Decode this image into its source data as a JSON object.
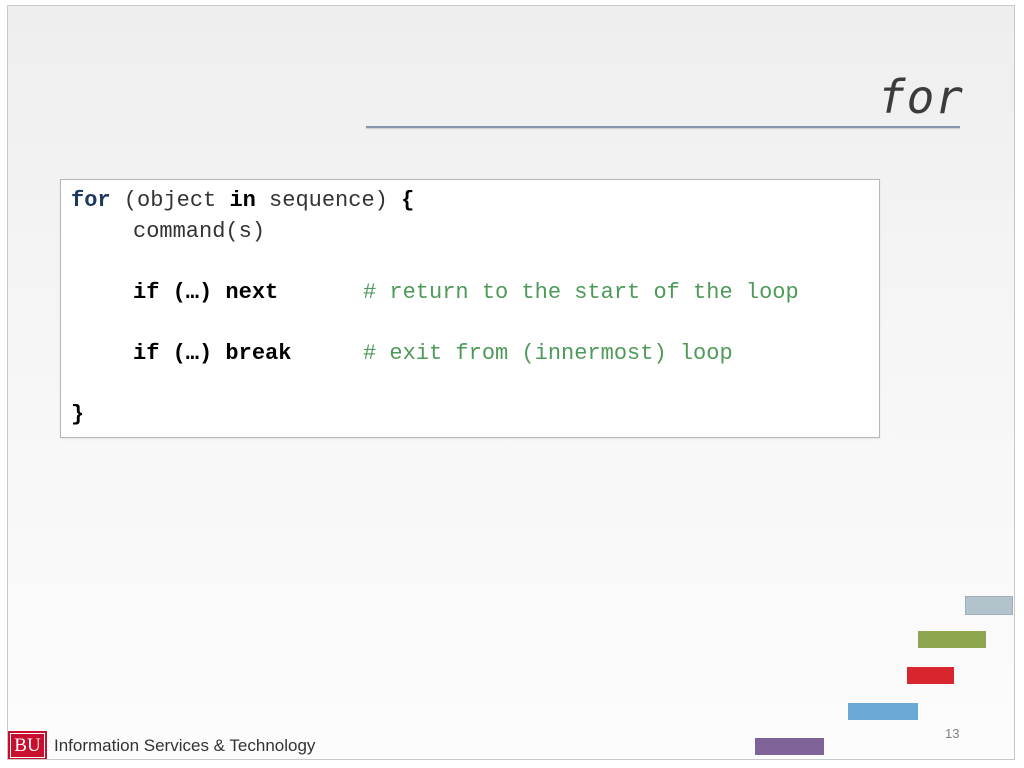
{
  "slide": {
    "title": "for",
    "page_number": "13"
  },
  "code": {
    "line1": {
      "kw1": "for",
      "p1": " (object ",
      "kw2": "in",
      "p2": " sequence) ",
      "brace": "{"
    },
    "line2": "command(s)",
    "line3": {
      "kw1": "if (…)",
      "kw2": " next",
      "comment": "# return to the start of the loop"
    },
    "line4": {
      "kw1": "if (…)",
      "kw2": " break",
      "comment": "# exit from (innermost) loop"
    },
    "line5": "}"
  },
  "footer": {
    "logo_mark": "BU",
    "org_name": "Information Services & Technology"
  },
  "decor_colors": [
    "#b3c3cc",
    "#8ea74f",
    "#d9262e",
    "#6aa9d6",
    "#7f6399"
  ]
}
